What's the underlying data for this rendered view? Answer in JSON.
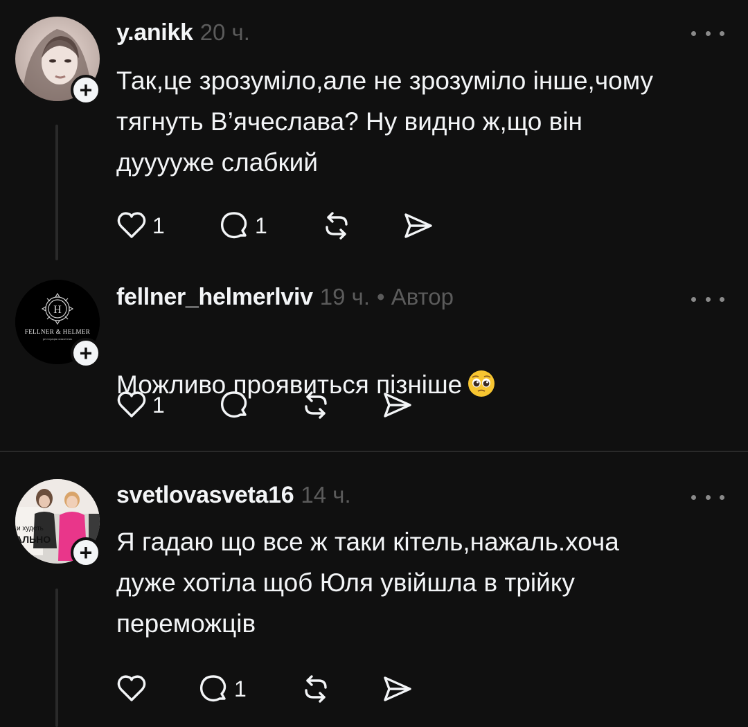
{
  "comments": [
    {
      "username": "y.anikk",
      "time": "20 ч.",
      "author_tag": "",
      "text": "Так,це зрозуміло,але не зрозуміло інше,чому\nтягнуть В’ячеслава? Ну видно ж,що він\nдууууже слабкий",
      "likes": "1",
      "replies": "1",
      "avatar_icon": "portrait-photo"
    },
    {
      "username": "fellner_helmerlviv",
      "time": "19 ч.",
      "author_tag": "• Автор",
      "text": "Можливо проявиться пізніше",
      "likes": "1",
      "replies": "",
      "avatar_icon": "brand-logo",
      "avatar_brand": "FELLNER & HELMER",
      "avatar_brand_sub": "ресторація шляхетних",
      "avatar_brand_letter": "H"
    },
    {
      "username": "svetlovasveta16",
      "time": "14 ч.",
      "author_tag": "",
      "text": "Я гадаю що все ж таки кітель,нажаль.хоча\nдуже хотіла щоб Юля увійшла в трійку\nпереможців",
      "likes": "",
      "replies": "1",
      "avatar_icon": "group-photo",
      "avatar_text_1": "и худеть",
      "avatar_text_2": "АЛЬНО"
    }
  ],
  "icons": {
    "like": "heart-icon",
    "reply": "speech-bubble-icon",
    "repost": "repost-arrows-icon",
    "share": "send-paper-plane-icon",
    "more": "more-dots-icon",
    "follow": "plus-icon",
    "emoji": "pleading-face-emoji"
  },
  "colors": {
    "background": "#101010",
    "text": "#f3f5f7",
    "muted": "#5b5b5b",
    "divider": "#2a2a2a"
  }
}
